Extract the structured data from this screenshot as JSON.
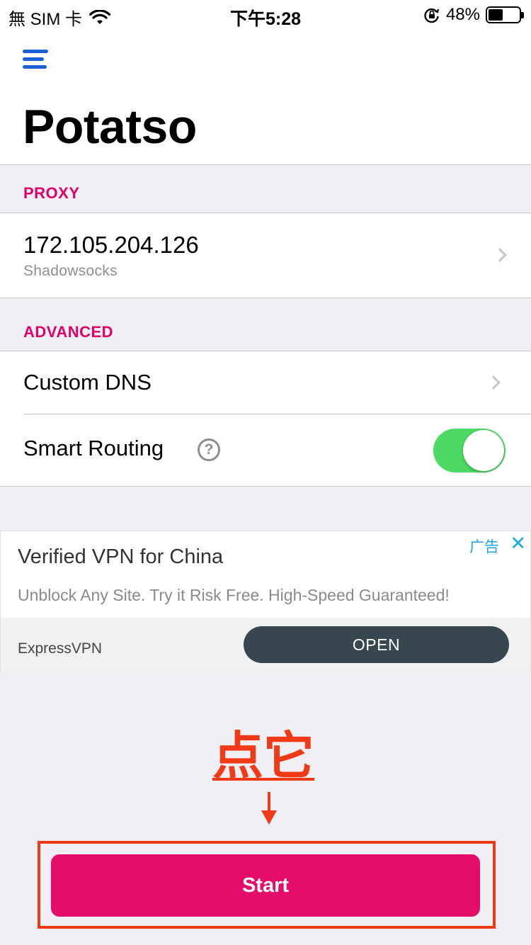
{
  "status_bar": {
    "carrier": "無 SIM 卡",
    "time": "下午5:28",
    "battery_percent": "48%",
    "battery_level": 0.48
  },
  "header": {
    "title": "Potatso",
    "menu_icon": "hamburger-menu-icon"
  },
  "proxy_section": {
    "header": "PROXY",
    "address": "172.105.204.126",
    "type": "Shadowsocks"
  },
  "advanced_section": {
    "header": "ADVANCED",
    "custom_dns_label": "Custom DNS",
    "smart_routing_label": "Smart Routing",
    "help_glyph": "?",
    "smart_routing_enabled": true
  },
  "ad": {
    "title": "Verified VPN for China",
    "description": "Unblock Any Site. Try it Risk Free. High-Speed Guaranteed!",
    "label": "广告",
    "close_glyph": "✕",
    "brand": "ExpressVPN",
    "cta": "OPEN"
  },
  "annotation": {
    "text": "点它"
  },
  "start_button": {
    "label": "Start"
  },
  "colors": {
    "accent": "#e40b6a",
    "section_header": "#e0006a",
    "toggle_on": "#4cd964",
    "annotation": "#f03a17",
    "menu_icon": "#1d5fd7",
    "ad_button": "#37464f"
  }
}
